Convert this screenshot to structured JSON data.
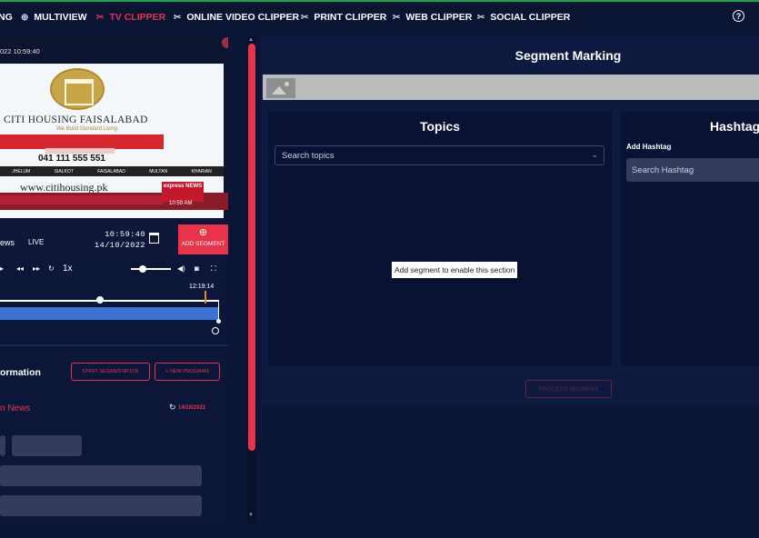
{
  "nav": {
    "items": [
      {
        "label": "NG",
        "icon": "none"
      },
      {
        "label": "MULTIVIEW",
        "icon": "globe-icon"
      },
      {
        "label": "TV CLIPPER",
        "icon": "scissors-icon",
        "active": true
      },
      {
        "label": "ONLINE VIDEO CLIPPER",
        "icon": "scissors-icon"
      },
      {
        "label": "PRINT CLIPPER",
        "icon": "scissors-icon"
      },
      {
        "label": "WEB CLIPPER",
        "icon": "scissors-icon"
      },
      {
        "label": "SOCIAL CLIPPER",
        "icon": "scissors-icon"
      }
    ],
    "help_label": "?"
  },
  "player": {
    "timestamp": "022 10:59:40",
    "ad": {
      "name": "CITI HOUSING FAISALABAD",
      "tagline": "We Build Standard Living",
      "phone": "041 111 555 551",
      "cities": [
        "JHELUM",
        "SIALKOT",
        "FAISALABAD",
        "MULTAN",
        "KHARIAN"
      ],
      "website": "www.citihousing.pk"
    },
    "news_logo": "express NEWS",
    "clock": "10:59 AM"
  },
  "info": {
    "channel": "ews",
    "live": "LIVE",
    "time": "10:59:40",
    "date": "14/10/2022",
    "add_segment": "ADD SEGMENT"
  },
  "controls": {
    "speed": "1x"
  },
  "timeline": {
    "end_time": "12:19:14",
    "progress": 0.44
  },
  "segment_info": {
    "title": "ormation",
    "start_button": "START SEGMENTATION",
    "new_program_button": "+ NEW PROGRAM",
    "channel_name": "n News",
    "refresh_date": "14/10/2022"
  },
  "marking": {
    "title": "Segment Marking",
    "topics_title": "Topics",
    "topics_placeholder": "Search topics",
    "tooltip": "Add segment to enable this section",
    "hashtag_title": "Hashtag",
    "add_hashtag_label": "Add Hashtag",
    "hashtag_placeholder": "Search Hashtag",
    "process_button": "PROCESS SEGMENT"
  },
  "colors": {
    "accent": "#e8334a",
    "background": "#0b1537",
    "panel": "#0f1a40",
    "timeline_fill": "#3d73d0"
  }
}
